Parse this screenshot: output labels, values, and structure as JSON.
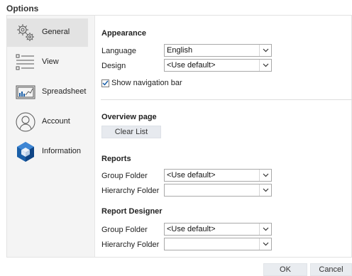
{
  "window": {
    "title": "Options"
  },
  "sidebar": {
    "items": [
      {
        "label": "General",
        "icon": "gears-icon",
        "active": true
      },
      {
        "label": "View",
        "icon": "list-view-icon",
        "active": false
      },
      {
        "label": "Spreadsheet",
        "icon": "spreadsheet-chart-icon",
        "active": false
      },
      {
        "label": "Account",
        "icon": "user-account-icon",
        "active": false
      },
      {
        "label": "Information",
        "icon": "information-cube-icon",
        "active": false
      }
    ]
  },
  "appearance": {
    "title": "Appearance",
    "language_label": "Language",
    "language_value": "English",
    "design_label": "Design",
    "design_value": "<Use default>",
    "show_nav_label": "Show navigation bar",
    "show_nav_checked": true
  },
  "overview": {
    "title": "Overview page",
    "clear_list_label": "Clear List"
  },
  "reports": {
    "title": "Reports",
    "group_folder_label": "Group Folder",
    "group_folder_value": "<Use default>",
    "hierarchy_folder_label": "Hierarchy Folder",
    "hierarchy_folder_value": ""
  },
  "report_designer": {
    "title": "Report Designer",
    "group_folder_label": "Group Folder",
    "group_folder_value": "<Use default>",
    "hierarchy_folder_label": "Hierarchy Folder",
    "hierarchy_folder_value": ""
  },
  "footer": {
    "ok_label": "OK",
    "cancel_label": "Cancel"
  },
  "colors": {
    "active_nav_bg": "#e3e3e3",
    "panel_bg": "#f4f4f4",
    "button_bg": "#e7eaef",
    "accent_blue": "#1a5fa8"
  }
}
